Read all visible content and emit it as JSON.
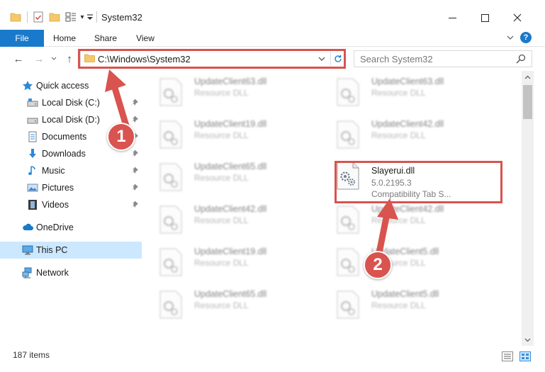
{
  "window": {
    "title": "System32",
    "dropdown_glyph": "▾",
    "minimize_glyph": "—",
    "maximize_glyph": "☐",
    "close_glyph": "✕"
  },
  "ribbon": {
    "tabs": [
      "File",
      "Home",
      "Share",
      "View"
    ],
    "expand_glyph": "⌄",
    "help_glyph": "?"
  },
  "navigation": {
    "back_glyph": "←",
    "forward_glyph": "→",
    "recent_glyph": "⌄",
    "up_glyph": "↑"
  },
  "address": {
    "path": "C:\\Windows\\System32",
    "dropdown_glyph": "⌄",
    "refresh_glyph": "↻"
  },
  "search": {
    "placeholder": "Search System32"
  },
  "sidebar": {
    "items": [
      {
        "label": "Quick access",
        "icon": "star-icon"
      },
      {
        "label": "Local Disk (C:)",
        "icon": "drive-icon"
      },
      {
        "label": "Local Disk (D:)",
        "icon": "drive-icon"
      },
      {
        "label": "Documents",
        "icon": "documents-icon"
      },
      {
        "label": "Downloads",
        "icon": "downloads-icon"
      },
      {
        "label": "Music",
        "icon": "music-icon"
      },
      {
        "label": "Pictures",
        "icon": "pictures-icon"
      },
      {
        "label": "Videos",
        "icon": "videos-icon"
      },
      {
        "label": "OneDrive",
        "icon": "cloud-icon"
      },
      {
        "label": "This PC",
        "icon": "computer-icon"
      },
      {
        "label": "Network",
        "icon": "network-icon"
      }
    ]
  },
  "files": [
    {
      "name": "UpdateClient63.dll",
      "desc": "Resource DLL"
    },
    {
      "name": "UpdateClient63.dll",
      "desc": "Resource DLL"
    },
    {
      "name": "UpdateClient19.dll",
      "desc": "Resource DLL"
    },
    {
      "name": "UpdateClient42.dll",
      "desc": "Resource DLL"
    },
    {
      "name": "UpdateClient65.dll",
      "desc": "Resource DLL"
    },
    {
      "name": "Slayerui.dll",
      "version": "5.0.2195.3",
      "desc": "Compatibility Tab S..."
    },
    {
      "name": "UpdateClient42.dll",
      "desc": "Resource DLL"
    },
    {
      "name": "UpdateClient42.dll",
      "desc": "Resource DLL"
    },
    {
      "name": "UpdateClient19.dll",
      "desc": "Resource DLL"
    },
    {
      "name": "UpdateClient5.dll",
      "desc": "Resource DLL"
    },
    {
      "name": "UpdateClient65.dll",
      "desc": "Resource DLL"
    },
    {
      "name": "UpdateClient5.dll",
      "desc": "Resource DLL"
    }
  ],
  "status": {
    "item_count": "187 items"
  },
  "annotations": {
    "callout_1": "1",
    "callout_2": "2",
    "color": "#d9534f"
  },
  "colors": {
    "file_tab": "#1979ca",
    "selection": "#cce8ff",
    "annotation_red": "#d9534f"
  }
}
